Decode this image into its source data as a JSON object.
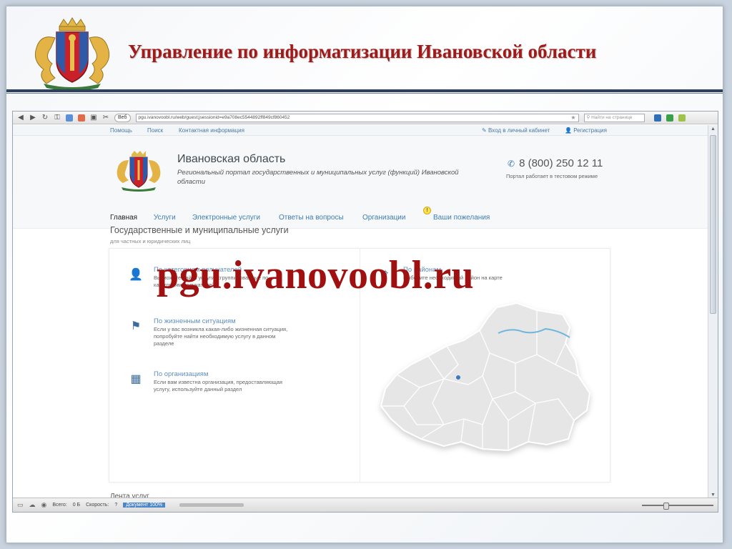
{
  "slide": {
    "title": "Управление по информатизации Ивановской области",
    "overlay_url": "pgu.ivanovoobl.ru"
  },
  "browser": {
    "web_button": "Веб",
    "address": "pgu.ivanovoobl.ru/web/guest;jsessionid=e9a708ec5544892ff849cf860452",
    "find_placeholder": "Найти на странице",
    "status": {
      "total_label": "Всего:",
      "total_value": "0 Б",
      "speed_label": "Скорость:",
      "speed_value": "?",
      "highlight": "Документ 100%"
    }
  },
  "site": {
    "topnav": {
      "help": "Помощь",
      "search": "Поиск",
      "contacts": "Контактная информация",
      "login": "Вход в личный кабинет",
      "register": "Регистрация"
    },
    "name": "Ивановская область",
    "description": "Региональный портал государственных и муниципальных услуг (функций) Ивановской области",
    "phone": "8 (800) 250 12 11",
    "phone_note": "Портал работает в тестовом режиме",
    "menu": {
      "home": "Главная",
      "services": "Услуги",
      "e_services": "Электронные услуги",
      "faq": "Ответы на вопросы",
      "orgs": "Организации",
      "wishes": "Ваши пожелания"
    },
    "section_title": "Государственные и муниципальные услуги",
    "section_sub": "для частных и юридических лиц",
    "items": [
      {
        "title": "По категориям получателей",
        "desc": "Вы можете найти услуги, сгруппированные по категориям получателей"
      },
      {
        "title": "По жизненным ситуациям",
        "desc": "Если у вас возникла какая-либо жизненная ситуация, попробуйте найти необходимую услугу в данном разделе"
      },
      {
        "title": "По организациям",
        "desc": "Если вам известна организация, предоставляющая услугу, используйте данный раздел"
      },
      {
        "title": "По районам",
        "desc": "Выберите необходимый район на карте"
      }
    ],
    "feed_title": "Лента услуг"
  },
  "colors": {
    "title_red": "#a01a1a",
    "link_blue": "#3d7cb5",
    "rule_navy": "#2e4060"
  }
}
